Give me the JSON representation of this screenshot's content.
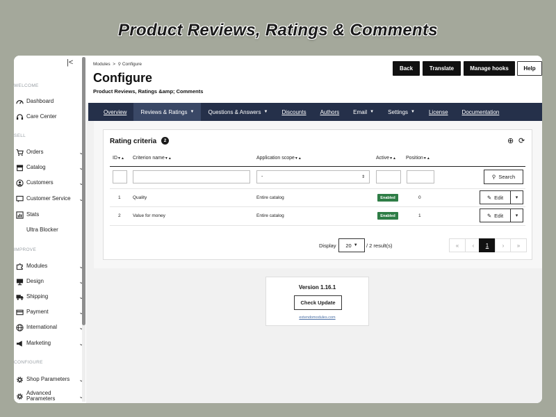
{
  "banner": "Product Reviews, Ratings & Comments",
  "sidebar": {
    "collapse_icon": "collapse-icon",
    "sections": [
      {
        "label": "WELCOME",
        "items": [
          {
            "label": "Dashboard",
            "icon": "dashboard-icon",
            "chevron": false
          },
          {
            "label": "Care Center",
            "icon": "headset-icon",
            "chevron": false
          }
        ]
      },
      {
        "label": "SELL",
        "items": [
          {
            "label": "Orders",
            "icon": "cart-icon",
            "chevron": true
          },
          {
            "label": "Catalog",
            "icon": "store-icon",
            "chevron": true
          },
          {
            "label": "Customers",
            "icon": "person-icon",
            "chevron": true
          },
          {
            "label": "Customer Service",
            "icon": "chat-icon",
            "chevron": true
          },
          {
            "label": "Stats",
            "icon": "chart-icon",
            "chevron": false
          },
          {
            "label": "Ultra Blocker",
            "icon": "shield-icon",
            "chevron": false
          }
        ]
      },
      {
        "label": "IMPROVE",
        "items": [
          {
            "label": "Modules",
            "icon": "puzzle-icon",
            "chevron": true
          },
          {
            "label": "Design",
            "icon": "monitor-icon",
            "chevron": true
          },
          {
            "label": "Shipping",
            "icon": "truck-icon",
            "chevron": true
          },
          {
            "label": "Payment",
            "icon": "credit-card-icon",
            "chevron": true
          },
          {
            "label": "International",
            "icon": "globe-icon",
            "chevron": true
          },
          {
            "label": "Marketing",
            "icon": "megaphone-icon",
            "chevron": true
          }
        ]
      },
      {
        "label": "CONFIGURE",
        "items": [
          {
            "label": "Shop Parameters",
            "icon": "gear-icon",
            "chevron": true
          },
          {
            "label": "Advanced Parameters",
            "icon": "gear-icon",
            "chevron": true
          }
        ]
      }
    ]
  },
  "header": {
    "breadcrumb": {
      "first": "Modules",
      "sep": ">",
      "current": "Configure"
    },
    "title": "Configure",
    "subtitle": "Product Reviews, Ratings &amp; Comments",
    "buttons": {
      "back": "Back",
      "translate": "Translate",
      "manage_hooks": "Manage hooks",
      "help": "Help"
    }
  },
  "tabs": [
    {
      "label": "Overview",
      "dropdown": false,
      "active": false
    },
    {
      "label": "Reviews & Ratings",
      "dropdown": true,
      "active": true
    },
    {
      "label": "Questions & Answers",
      "dropdown": true,
      "active": false
    },
    {
      "label": "Discounts",
      "dropdown": false,
      "active": false
    },
    {
      "label": "Authors",
      "dropdown": false,
      "active": false
    },
    {
      "label": "Email",
      "dropdown": true,
      "active": false
    },
    {
      "label": "Settings",
      "dropdown": true,
      "active": false
    },
    {
      "label": "License",
      "dropdown": false,
      "active": false
    },
    {
      "label": "Documentation",
      "dropdown": false,
      "active": false
    }
  ],
  "panel": {
    "title": "Rating criteria",
    "count": "2",
    "add_icon": "plus-circle-icon",
    "refresh_icon": "refresh-icon",
    "columns": {
      "id": "ID",
      "name": "Criterion name",
      "scope": "Application scope",
      "active": "Active",
      "position": "Position"
    },
    "filter": {
      "scope_value": "-",
      "search_label": "Search"
    },
    "rows": [
      {
        "id": "1",
        "name": "Quality",
        "scope": "Entire catalog",
        "status": "Enabled",
        "position": "0",
        "edit": "Edit"
      },
      {
        "id": "2",
        "name": "Value for money",
        "scope": "Entire catalog",
        "status": "Enabled",
        "position": "1",
        "edit": "Edit"
      }
    ],
    "pagination": {
      "display_label": "Display",
      "per_page": "20",
      "results": "/ 2 result(s)",
      "first": "«",
      "prev": "‹",
      "page": "1",
      "next": "›",
      "last": "»"
    }
  },
  "version": {
    "text": "Version 1.16.1",
    "button": "Check Update",
    "link": "extendomodules.com"
  },
  "colors": {
    "nav_bg": "#25304a",
    "nav_active": "#3a4866",
    "enabled_badge": "#2e7d46"
  }
}
